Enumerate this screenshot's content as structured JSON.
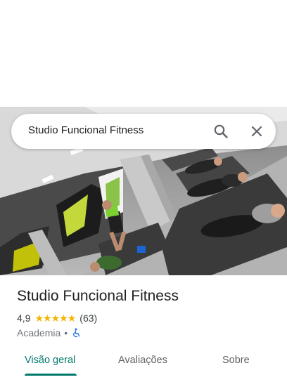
{
  "search": {
    "query": "Studio Funcional Fitness"
  },
  "place": {
    "name": "Studio Funcional Fitness",
    "rating": "4,9",
    "stars": [
      "★",
      "★",
      "★",
      "★",
      "★"
    ],
    "review_count": "(63)",
    "category": "Academia",
    "separator": "•"
  },
  "tabs": [
    {
      "label": "Visão geral",
      "active": true
    },
    {
      "label": "Avaliações",
      "active": false
    },
    {
      "label": "Sobre",
      "active": false
    }
  ],
  "icons": {
    "search": "search-icon",
    "close": "close-icon",
    "accessibility": "wheelchair-accessible-icon"
  },
  "colors": {
    "accent": "#00796b",
    "star": "#f4b400",
    "accessible_icon": "#1a73e8"
  }
}
